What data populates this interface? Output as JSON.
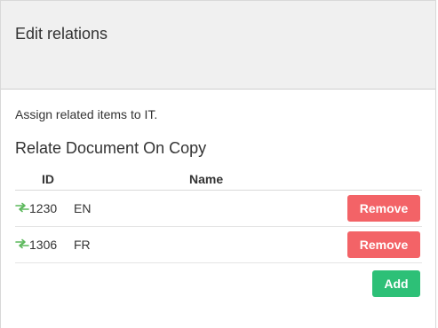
{
  "dialog": {
    "title": "Edit relations"
  },
  "intro_text": "Assign related items to IT.",
  "section": {
    "title": "Relate Document On Copy"
  },
  "table": {
    "columns": {
      "id": "ID",
      "name": "Name"
    },
    "rows": [
      {
        "id": "1230",
        "name": "EN",
        "remove_label": "Remove",
        "icon": "link-arrows-icon"
      },
      {
        "id": "1306",
        "name": "FR",
        "remove_label": "Remove",
        "icon": "link-arrows-icon"
      }
    ]
  },
  "add_label": "Add",
  "colors": {
    "remove": "#f36367",
    "add": "#2dc077",
    "link_icon": "#5cb85c",
    "header_bg": "#f0f0f0"
  }
}
